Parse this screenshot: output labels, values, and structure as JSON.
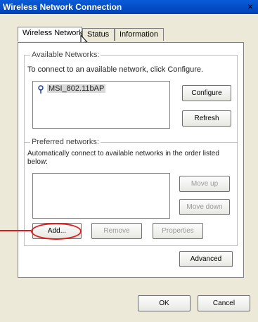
{
  "window": {
    "title": "Wireless Network Connection"
  },
  "tabs": [
    {
      "label": "Wireless Network"
    },
    {
      "label": "Status"
    },
    {
      "label": "Information"
    }
  ],
  "available": {
    "group_label": "Available Networks:",
    "description": "To connect to an available network, click Configure.",
    "network_item": "MSI_802.11bAP",
    "configure_label": "Configure",
    "refresh_label": "Refresh"
  },
  "preferred": {
    "group_label": "Preferred networks:",
    "description_line1": "Automatically connect to available networks in the order listed",
    "description_line2": "below:",
    "move_up_label": "Move up",
    "move_down_label": "Move down",
    "add_label": "Add...",
    "remove_label": "Remove",
    "properties_label": "Properties"
  },
  "advanced_label": "Advanced",
  "ok_label": "OK",
  "cancel_label": "Cancel",
  "colors": {
    "title_bar": "#0a5bd8",
    "annotation": "#e21a1a"
  }
}
